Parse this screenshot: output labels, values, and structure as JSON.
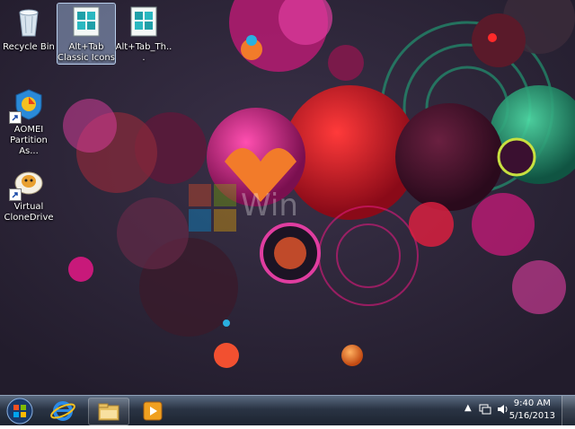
{
  "desktop": {
    "icons": [
      {
        "label": "Recycle Bin",
        "icon": "recycle-bin-icon"
      },
      {
        "label": "Alt+Tab Classic Icons",
        "icon": "archive-file-icon"
      },
      {
        "label": "Alt+Tab_Th...",
        "icon": "archive-file-icon"
      },
      {
        "label": "AOMEI Partition As...",
        "icon": "aomei-partition-icon"
      },
      {
        "label": "Virtual CloneDrive",
        "icon": "sheep-clonedrive-icon"
      }
    ],
    "watermark": "Win"
  },
  "taskbar": {
    "pinned": [
      "start-orb-icon",
      "internet-explorer-icon",
      "file-explorer-icon",
      "media-player-icon"
    ],
    "tray_icons": [
      "show-hidden-icons-arrow",
      "network-icon",
      "volume-icon"
    ],
    "clock_time": "9:40 AM",
    "clock_date": "5/16/2013"
  },
  "colors": {
    "background": "#2b2438",
    "accent_magenta": "#e0197d",
    "accent_red": "#d8152a",
    "accent_green": "#1fa77a",
    "accent_orange": "#f27b2a"
  }
}
